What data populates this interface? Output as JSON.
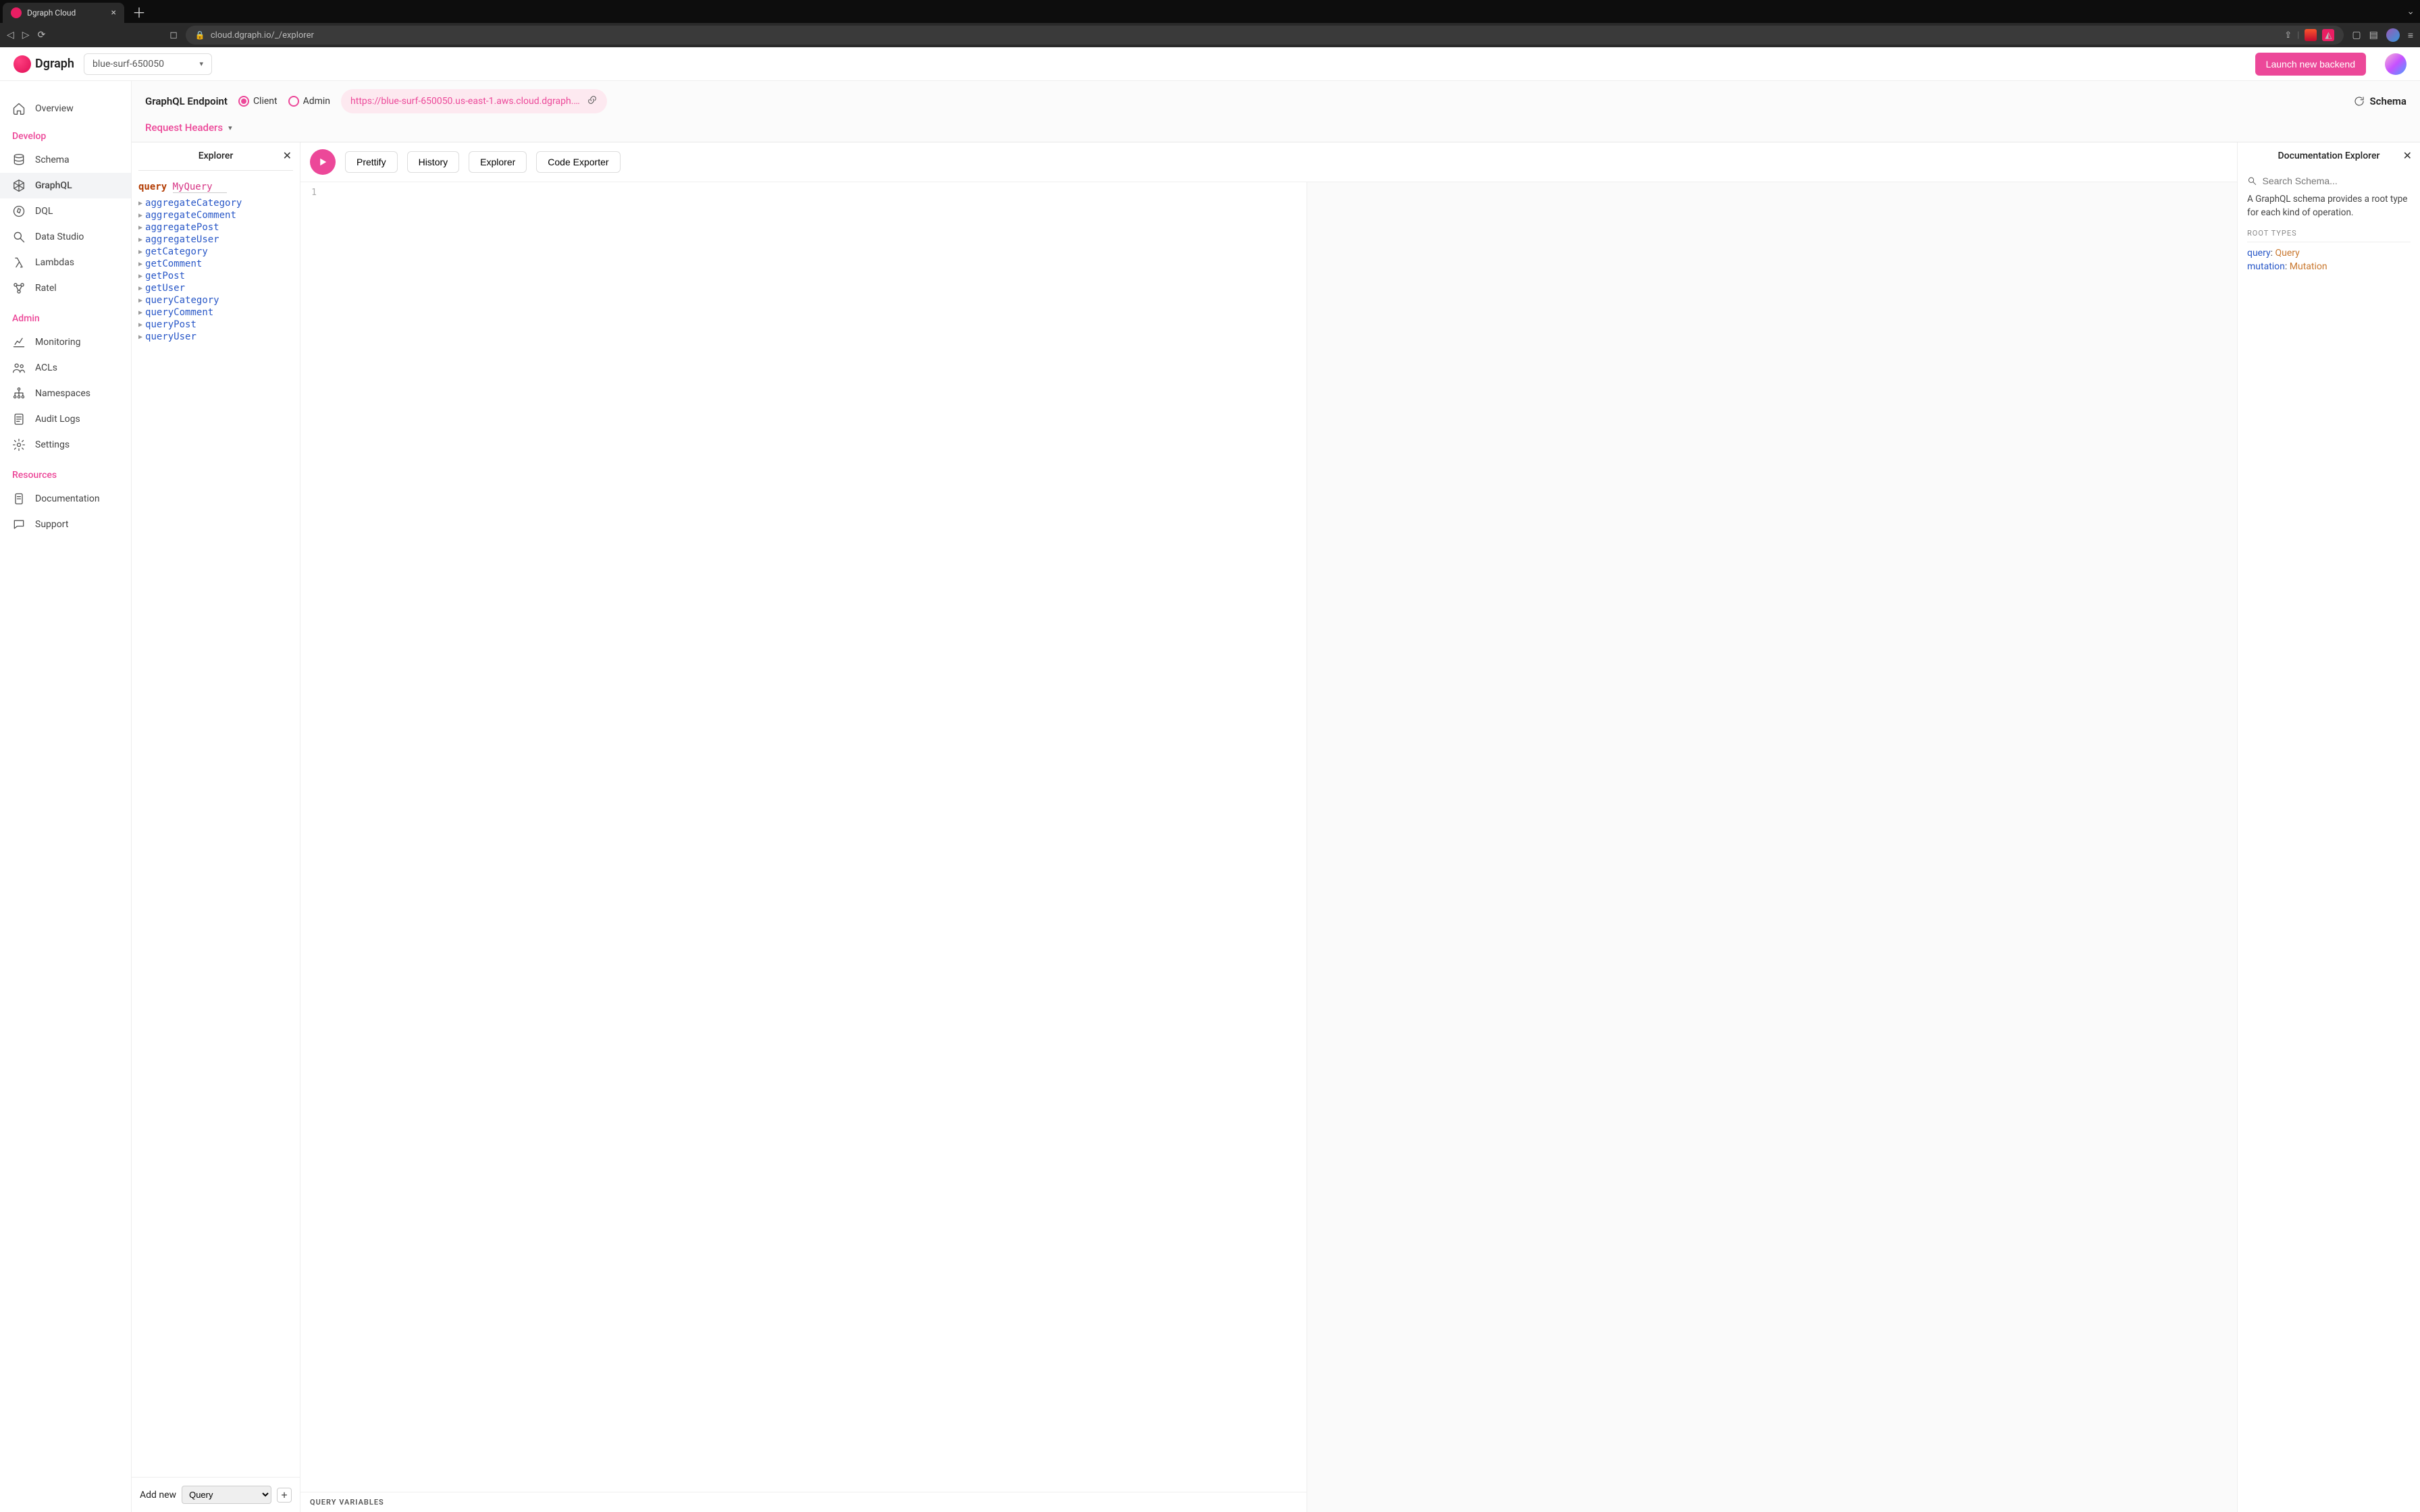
{
  "browser": {
    "tab_title": "Dgraph Cloud",
    "url": "cloud.dgraph.io/_/explorer"
  },
  "header": {
    "brand": "Dgraph",
    "backend_selected": "blue-surf-650050",
    "launch_label": "Launch new backend"
  },
  "sidenav": {
    "overview": "Overview",
    "sections": {
      "develop": {
        "title": "Develop",
        "items": [
          "Schema",
          "GraphQL",
          "DQL",
          "Data Studio",
          "Lambdas",
          "Ratel"
        ]
      },
      "admin": {
        "title": "Admin",
        "items": [
          "Monitoring",
          "ACLs",
          "Namespaces",
          "Audit Logs",
          "Settings"
        ]
      },
      "resources": {
        "title": "Resources",
        "items": [
          "Documentation",
          "Support"
        ]
      }
    }
  },
  "context": {
    "endpoint_label": "GraphQL Endpoint",
    "client_label": "Client",
    "admin_label": "Admin",
    "endpoint_url": "https://blue-surf-650050.us-east-1.aws.cloud.dgraph.io/grap...",
    "request_headers_label": "Request Headers",
    "schema_label": "Schema"
  },
  "explorer": {
    "title": "Explorer",
    "query_keyword": "query",
    "query_name": "MyQuery",
    "fields": [
      "aggregateCategory",
      "aggregateComment",
      "aggregatePost",
      "aggregateUser",
      "getCategory",
      "getComment",
      "getPost",
      "getUser",
      "queryCategory",
      "queryComment",
      "queryPost",
      "queryUser"
    ],
    "add_new_label": "Add new",
    "add_new_options": [
      "Query"
    ]
  },
  "editor": {
    "buttons": {
      "prettify": "Prettify",
      "history": "History",
      "explorer": "Explorer",
      "code_exporter": "Code Exporter"
    },
    "line_number": "1",
    "vars_label": "QUERY VARIABLES"
  },
  "docs": {
    "title": "Documentation Explorer",
    "search_placeholder": "Search Schema...",
    "description": "A GraphQL schema provides a root type for each kind of operation.",
    "root_types_label": "ROOT TYPES",
    "roots": [
      {
        "field": "query",
        "type": "Query"
      },
      {
        "field": "mutation",
        "type": "Mutation"
      }
    ]
  }
}
